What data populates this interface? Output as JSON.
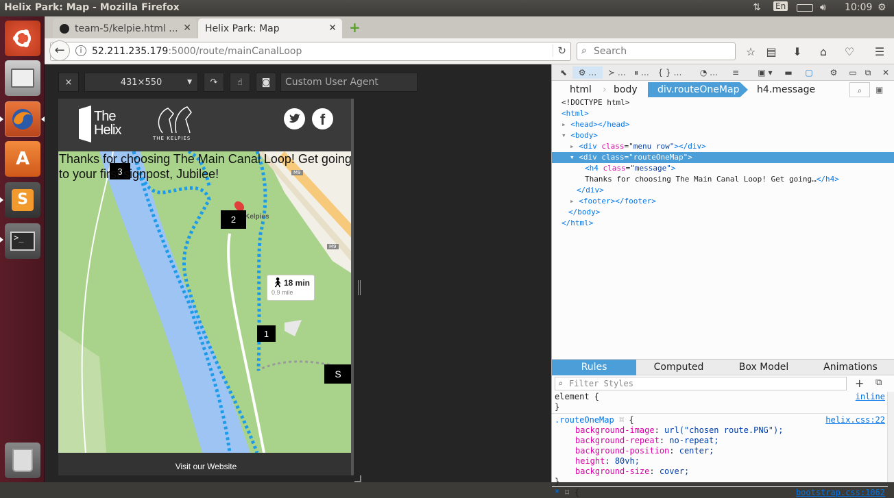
{
  "window": {
    "title": "Helix Park: Map - Mozilla Firefox"
  },
  "indicators": {
    "keyboard": "En",
    "clock": "10:09"
  },
  "launcher": {
    "items": [
      "ubuntu-dash",
      "files",
      "firefox",
      "software-center",
      "sublime-text",
      "terminal",
      "trash"
    ]
  },
  "tabs": [
    {
      "label": "team-5/kelpie.html ...",
      "icon": "github-icon"
    },
    {
      "label": "Helix Park: Map",
      "icon": ""
    }
  ],
  "navbar": {
    "url_host": "52.211.235.179",
    "url_path": ":5000/route/mainCanalLoop",
    "search_placeholder": "Search"
  },
  "rdm": {
    "close": "×",
    "size": "431×550",
    "user_agent_placeholder": "Custom User Agent"
  },
  "site": {
    "logo_text": "The Helix",
    "kelpies_text": "THE KELPIES",
    "message": "Thanks for choosing The Main Canal Loop! Get going to your first signpost, Jubilee!",
    "map_place_label": "Kelpies",
    "route_time": "18 min",
    "route_distance": "0.9 mile",
    "road_label_1": "M9",
    "road_label_2": "M9",
    "markers": [
      "3",
      "2",
      "1",
      "S"
    ],
    "footer_link": "Visit our Website"
  },
  "devtools": {
    "breadcrumbs": [
      "html",
      "body",
      "div.routeOneMap",
      "h4.message"
    ],
    "markup": {
      "doctype": "<!DOCTYPE html>",
      "html_open": "html",
      "head": "head",
      "body": "body",
      "menu_div_class": "menu row",
      "route_div_class": "routeOneMap",
      "h4_class": "message",
      "h4_text": "Thanks for choosing The Main Canal Loop! Get going…",
      "footer": "footer"
    },
    "side_tabs": [
      "Rules",
      "Computed",
      "Box Model",
      "Animations"
    ],
    "filter_placeholder": "Filter Styles",
    "rules": {
      "element_selector": "element {",
      "element_source": "inline",
      "route_selector": ".routeOneMap",
      "route_source": "helix.css:22",
      "props": [
        {
          "name": "background-image",
          "value": "url(\"chosen route.PNG\");"
        },
        {
          "name": "background-repeat",
          "value": "no-repeat;"
        },
        {
          "name": "background-position",
          "value": "center;"
        },
        {
          "name": "height",
          "value": "80vh;"
        },
        {
          "name": "background-size",
          "value": "cover;"
        }
      ],
      "star_selector": "* ",
      "star_source": "bootstrap.css:1062"
    }
  }
}
